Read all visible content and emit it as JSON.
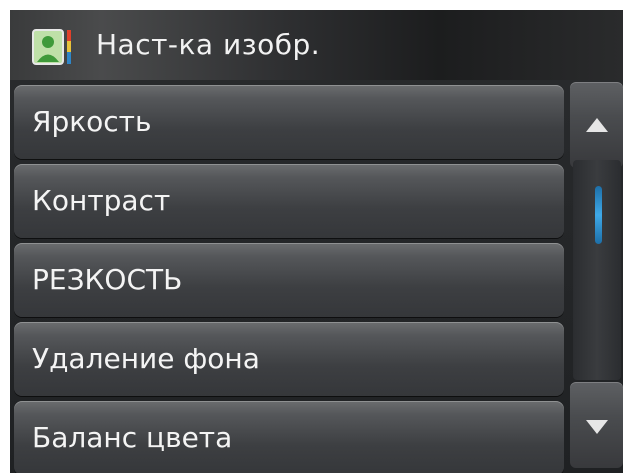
{
  "header": {
    "title": "Наст-ка изобр.",
    "icon": "image-settings-icon"
  },
  "menu": {
    "items": [
      {
        "label": "Яркость"
      },
      {
        "label": "Контраст"
      },
      {
        "label": "РЕЗКОСТЬ"
      },
      {
        "label": "Удаление фона"
      },
      {
        "label": "Баланс цвета"
      }
    ]
  },
  "scrollbar": {
    "up_icon": "arrow-up-icon",
    "down_icon": "arrow-down-icon",
    "thumb_color": "#3fa9e8"
  }
}
